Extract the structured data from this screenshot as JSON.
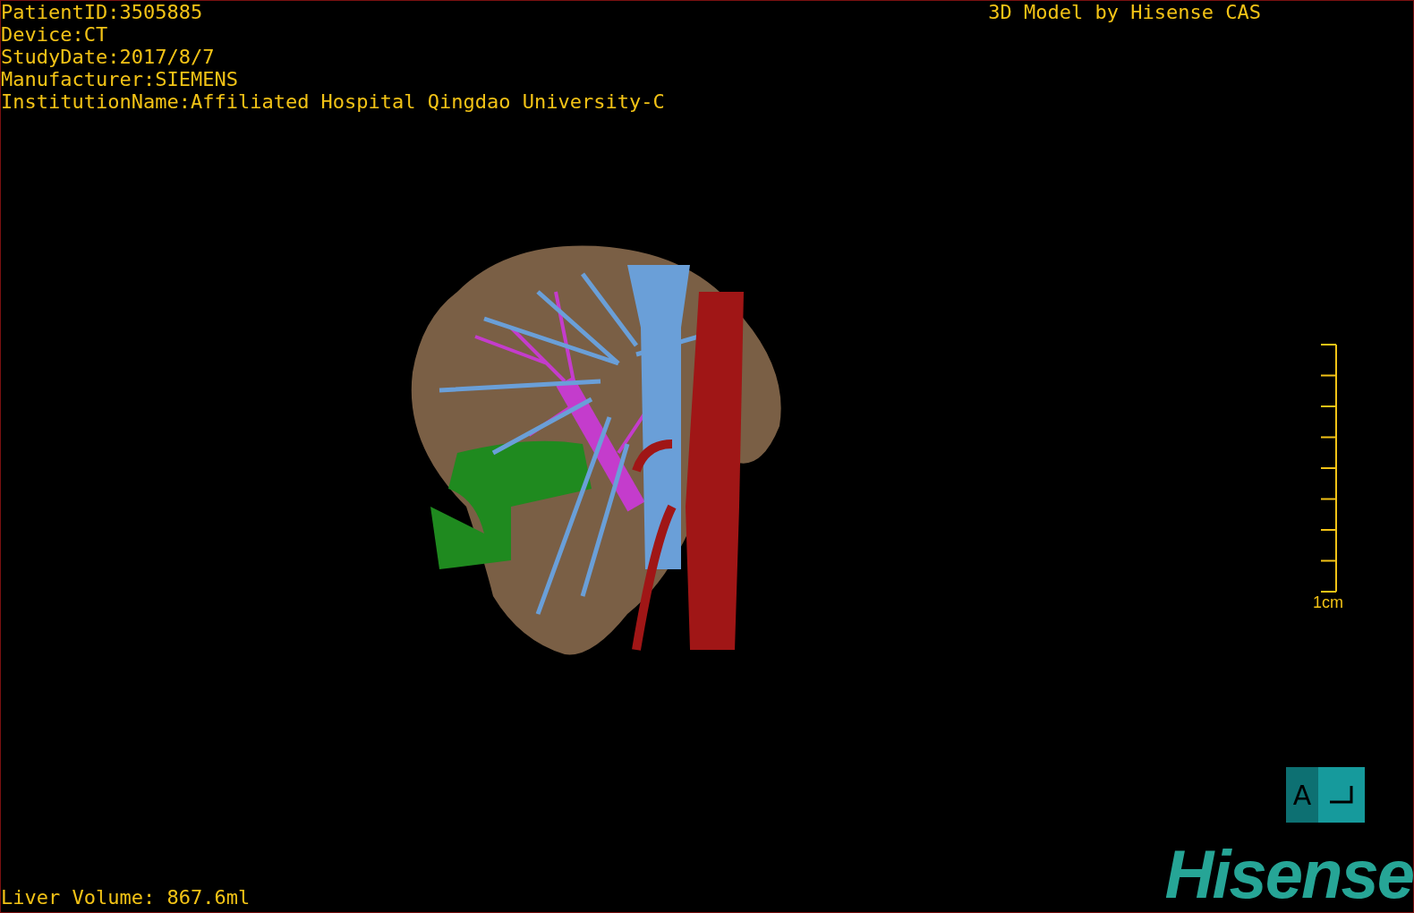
{
  "study_info": [
    "PatientID:3505885",
    "Device:CT",
    "StudyDate:2017/8/7",
    "Manufacturer:SIEMENS",
    "InstitutionName:Affiliated Hospital Qingdao University-C"
  ],
  "title": "3D Model by Hisense CAS",
  "scale_bar": {
    "label": "1cm"
  },
  "liver_volume": "Liver Volume: 867.6ml",
  "orientation_button": {
    "label": "A"
  },
  "logo": "Hisense"
}
